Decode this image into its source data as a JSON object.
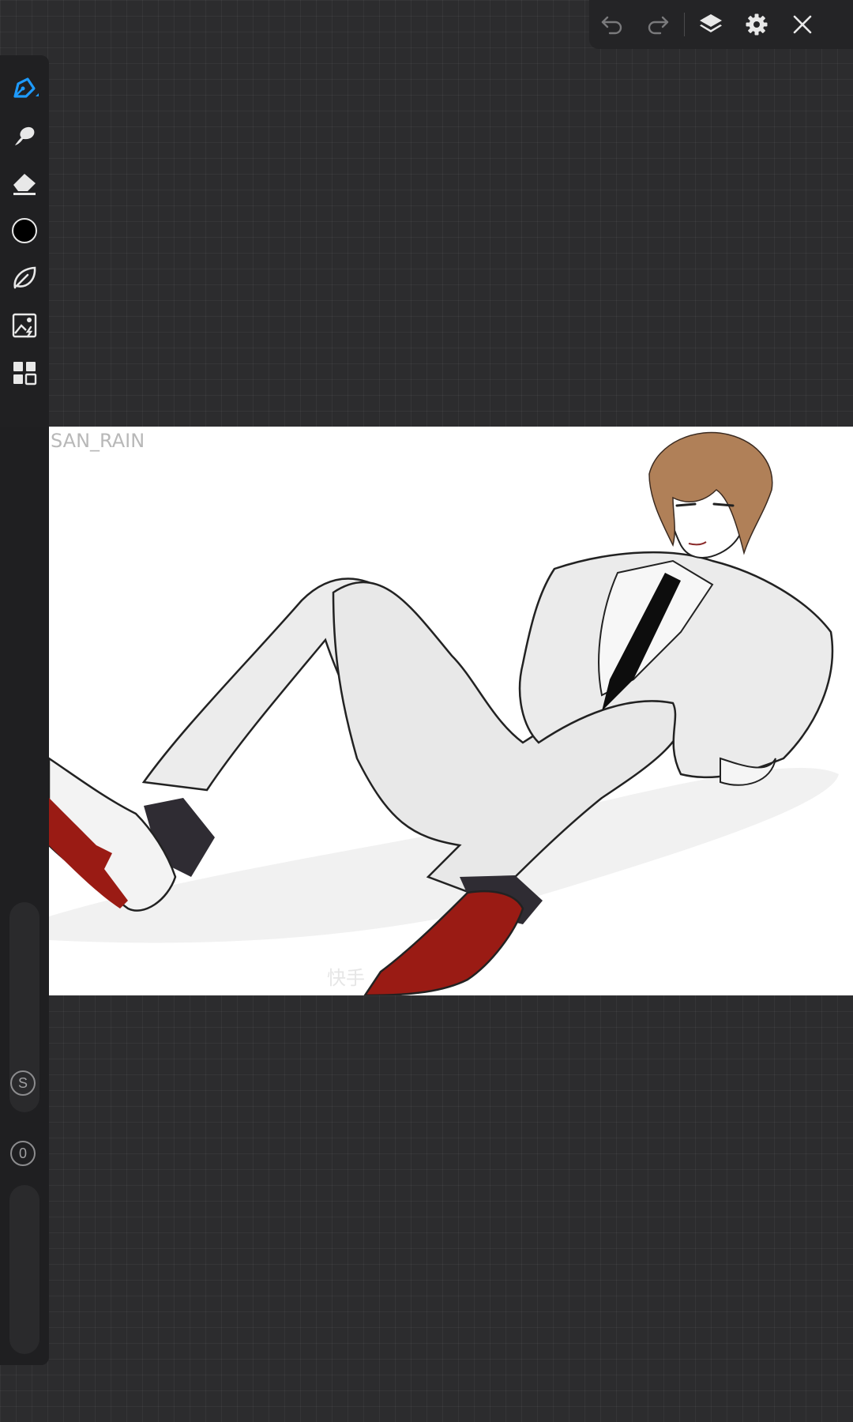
{
  "app": {
    "topbar": {
      "undo_icon": "undo-icon",
      "redo_icon": "redo-icon",
      "layers_icon": "layers-icon",
      "settings_icon": "gear-icon",
      "close_icon": "close-icon"
    },
    "toolbar": [
      {
        "name": "brush-tool",
        "icon": "pen-icon",
        "active": true
      },
      {
        "name": "smudge-tool",
        "icon": "smudge-icon"
      },
      {
        "name": "eraser-tool",
        "icon": "eraser-icon"
      },
      {
        "name": "color-picker",
        "icon": "color-circle-icon",
        "color": "#000000"
      },
      {
        "name": "lasso-tool",
        "icon": "lasso-icon"
      },
      {
        "name": "import-image",
        "icon": "image-import-icon"
      },
      {
        "name": "more-tools",
        "icon": "grid-icon"
      }
    ],
    "side_controls": {
      "size_label": "S",
      "opacity_label": "0"
    },
    "canvas": {
      "watermark": "SAN_RAIN",
      "watermark_bottom": "快手"
    },
    "colors": {
      "accent": "#1e9bff",
      "background": "#2c2c2e",
      "panel": "#202022"
    }
  }
}
